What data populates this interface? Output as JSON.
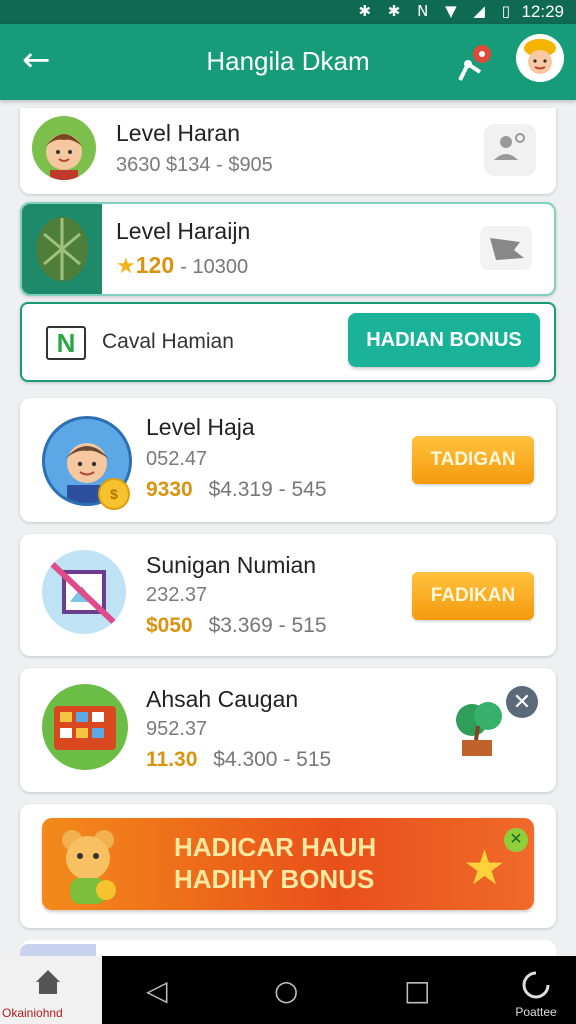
{
  "status_bar": {
    "icons": "✱ ✱ N ▼ ◢ ▯",
    "time": "12:29"
  },
  "header": {
    "title": "Hangila Dkam",
    "back_icon": "arrow-left-icon",
    "network_icon": "network-icon",
    "avatar": "user-avatar"
  },
  "profile_card": {
    "title": "Level Haran",
    "subtitle": "3630 $134 - $905"
  },
  "level_card": {
    "title": "Level Haraijn",
    "points": "120",
    "points_total": "- 10300"
  },
  "bonus_row": {
    "label": "Caval Hamian",
    "button": "HADIAN BONUS"
  },
  "items": [
    {
      "title": "Level Haja",
      "code": "052.47",
      "amount": "9330",
      "range": "$4.319 - 545",
      "button": "TADIGAN"
    },
    {
      "title": "Sunigan Numian",
      "code": "232.37",
      "amount": "$050",
      "range": "$3.369 - 515",
      "button": "FADIKAN"
    },
    {
      "title": "Ahsah Caugan",
      "code": "952.37",
      "amount": "11.30",
      "range": "$4.300 - 515"
    }
  ],
  "banner": {
    "line1": "HADICAR HAUH",
    "line2": "HADIHY BONUS"
  },
  "nav": {
    "home_label": "Okainiohnd",
    "right_label": "Poattee"
  },
  "colors": {
    "primary": "#169c78",
    "accent_orange": "#f59a0e",
    "banner_orange": "#e8501a",
    "gold": "#d9930f"
  }
}
